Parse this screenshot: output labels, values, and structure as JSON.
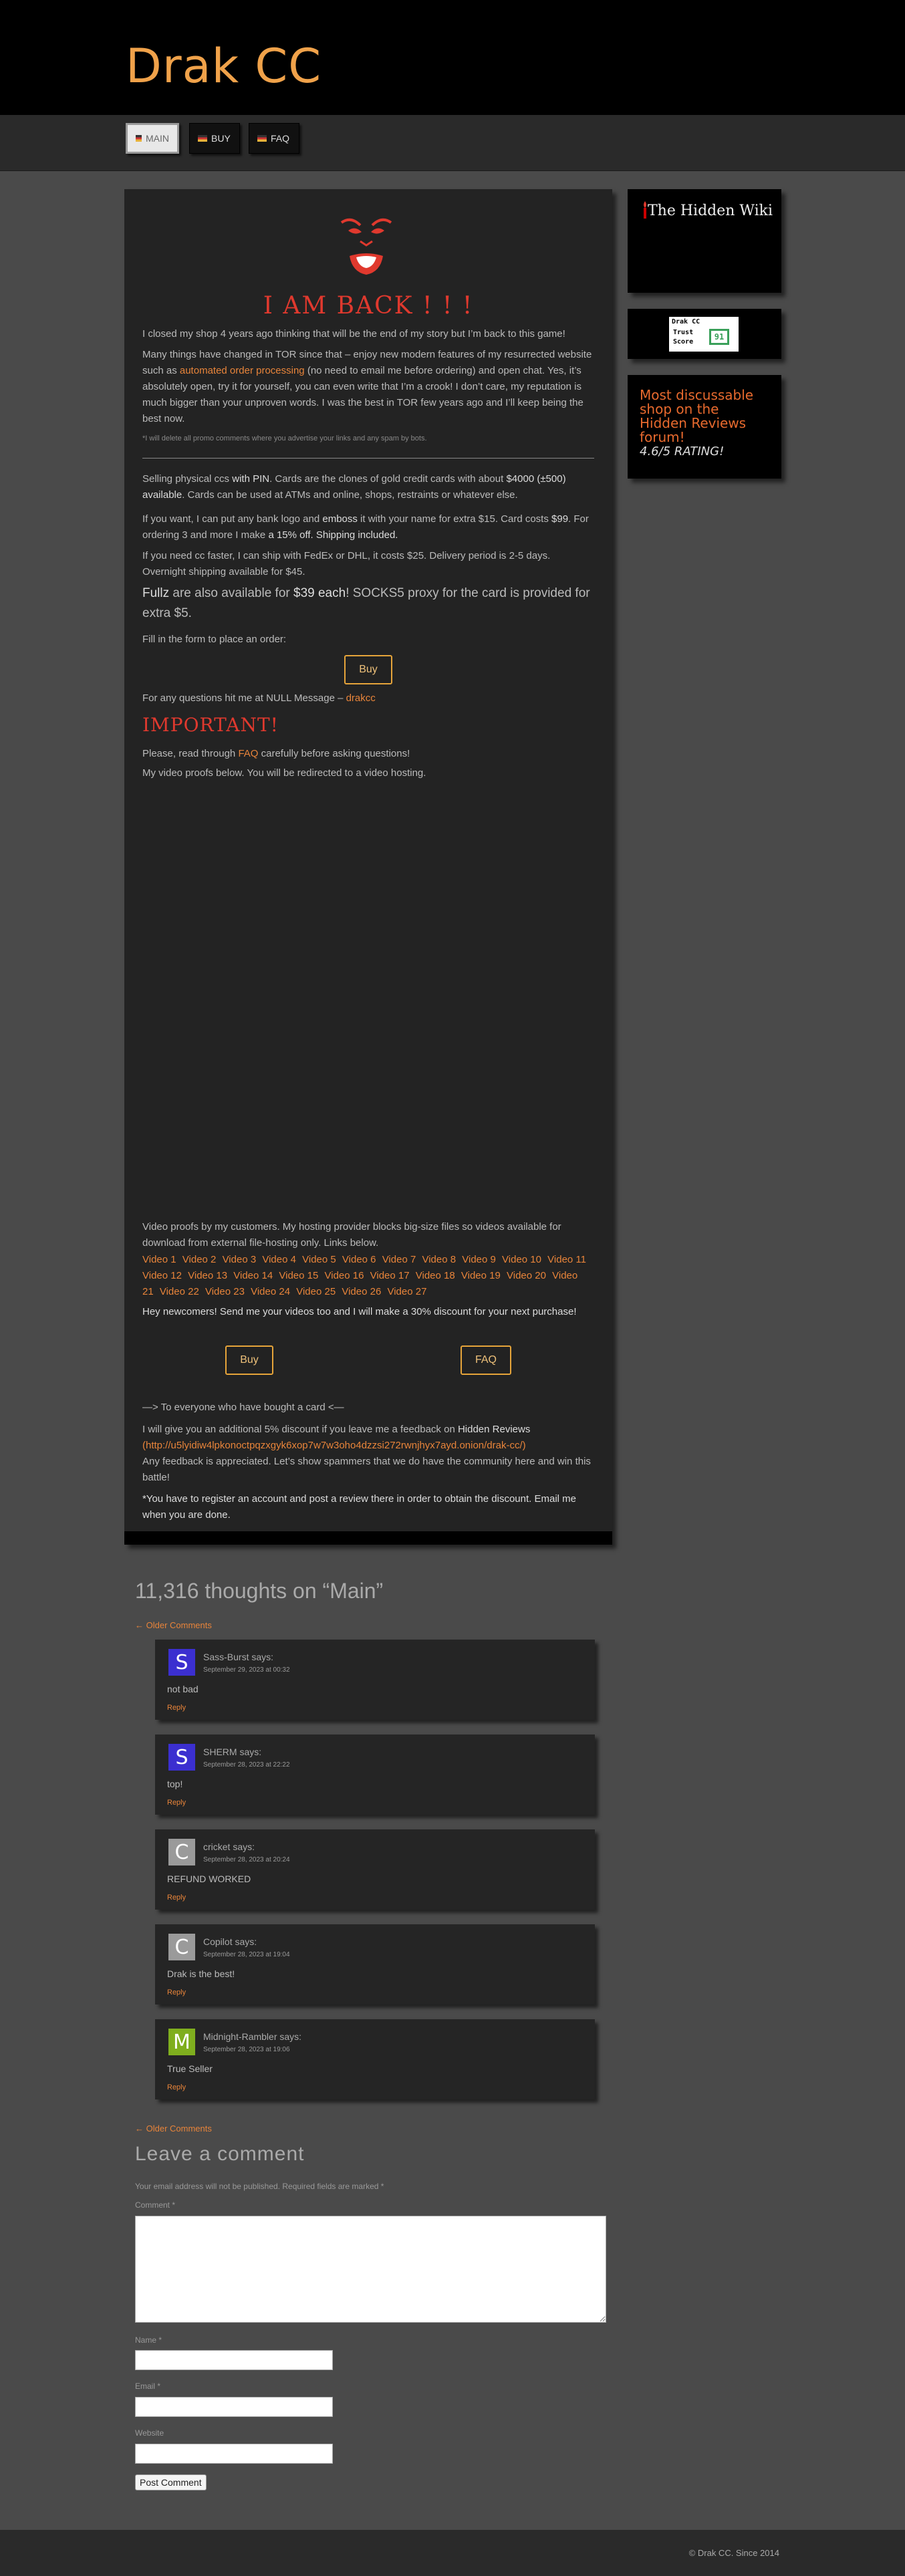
{
  "site": {
    "title": "Drak CC"
  },
  "nav": [
    {
      "label": "MAIN",
      "active": true
    },
    {
      "label": "BUY",
      "active": false
    },
    {
      "label": "FAQ",
      "active": false
    }
  ],
  "main": {
    "heading": "I AM BACK ! ! !",
    "intro": "I closed my shop 4 years ago thinking that will be the end of my story but I’m back to this game!",
    "p2_a": "Many things have changed in TOR since that – enjoy new modern features of my resurrected website such as ",
    "p2_link": "automated order processing",
    "p2_b": " (no need to email me before ordering) and open chat. Yes, it’s absolutely open, try it for yourself, you can even write that I’m a crook! I don’t care, my reputation is much bigger than your unproven words. I was the best in TOR few years ago and I’ll keep being the best now.",
    "note": "*I will delete all promo comments where you advertise your links and any spam by bots.",
    "p3_a": "Selling physical ccs ",
    "p3_b": "with PIN",
    "p3_c": ". Cards are the clones of gold credit cards with about ",
    "p3_d": "$4000 (±500) available",
    "p3_e": ". Cards can be used at ATMs and online, shops, restraints or whatever else.",
    "p4_a": "If you want, I can put any bank logo and ",
    "p4_b": "emboss",
    "p4_c": " it with your name for extra $15. Card costs ",
    "p4_d": "$99",
    "p4_e": ". For ordering 3 and more I make ",
    "p4_f": "a 15% off. Shipping included.",
    "p5": "If you need cc faster, I can ship with FedEx or DHL, it costs $25. Delivery period is 2-5 days. Overnight shipping available for $45.",
    "p6_a": "Fullz",
    "p6_b": " are also available for ",
    "p6_c": "$39 each",
    "p6_d": "! SOCKS5 proxy for the card is provided for extra $5.",
    "p7": "Fill in the form to place an order:",
    "buy_label": "Buy",
    "p8_a": "For any questions hit me at NULL Message – ",
    "p8_link": "drakcc",
    "important": "IMPORTANT!",
    "p9_a": "Please, read through ",
    "p9_link": "FAQ",
    "p9_b": " carefully before asking questions!",
    "p10": "My video proofs below. You will be redirected to a video hosting.",
    "p11": "Video proofs by my customers. My hosting provider blocks big-size files so videos available for download from external file-hosting only. Links below.",
    "videos": [
      "Video 1",
      "Video 2",
      "Video 3",
      "Video 4",
      "Video 5",
      "Video 6",
      "Video 7",
      "Video 8",
      "Video 9",
      "Video 10",
      "Video 11",
      "Video 12",
      "Video 13",
      "Video 14",
      "Video 15",
      "Video 16",
      "Video 17",
      "Video 18",
      "Video 19",
      "Video 20",
      "Video 21",
      "Video 22",
      "Video 23",
      "Video 24",
      "Video 25",
      "Video 26",
      "Video 27"
    ],
    "p12": "Hey newcomers! Send me your videos too and I will make a 30% discount for your next purchase!",
    "buy2_label": "Buy",
    "faq_label": "FAQ",
    "p13": "—> To everyone who have bought a card <—",
    "p14_a": "I will give you an additional 5% discount if you leave me a feedback on ",
    "p14_b": "Hidden Reviews",
    "p14_link": "(http://u5lyidiw4lpkonoctpqzxgyk6xop7w7w3oho4dzzsi272rwnjhyx7ayd.onion/drak-cc/)",
    "p14_c": "Any feedback is appreciated. Let’s show spammers that we do have the community here and win this battle!",
    "p15": "*You have to register an account and post a review there in order to obtain the discount. Email me when you are done."
  },
  "sidebar": {
    "wiki_text": "The Hidden Wiki",
    "trust_brand": "Drak CC",
    "trust_line1": "Trust",
    "trust_line2": "Score",
    "trust_score": "91",
    "reviews_text": "Most discussable shop on the Hidden Reviews forum!",
    "reviews_rating": "4.6/5 RATING!"
  },
  "comments": {
    "title": "11,316 thoughts on “Main”",
    "older_label": "← Older Comments",
    "reply_label": "Reply",
    "says": "says:",
    "items": [
      {
        "initial": "S",
        "author": "Sass-Burst",
        "date": "September 29, 2023 at 00:32",
        "text": "not bad",
        "color": "#3b2fd0"
      },
      {
        "initial": "S",
        "author": "SHERM",
        "date": "September 28, 2023 at 22:22",
        "text": "top!",
        "color": "#3b2fd0"
      },
      {
        "initial": "C",
        "author": "cricket",
        "date": "September 28, 2023 at 20:24",
        "text": "REFUND WORKED",
        "color": "#9a9a9a"
      },
      {
        "initial": "C",
        "author": "Copilot",
        "date": "September 28, 2023 at 19:04",
        "text": "Drak is the best!",
        "color": "#9a9a9a"
      },
      {
        "initial": "M",
        "author": "Midnight-Rambler",
        "date": "September 28, 2023 at 19:06",
        "text": "True Seller",
        "color": "#7fae1e"
      }
    ]
  },
  "form": {
    "title": "Leave a comment",
    "notice": "Your email address will not be published. Required fields are marked *",
    "comment_label": "Comment *",
    "name_label": "Name *",
    "email_label": "Email *",
    "website_label": "Website",
    "submit_label": "Post Comment"
  },
  "footer": {
    "text": "© Drak CC. Since 2014"
  }
}
